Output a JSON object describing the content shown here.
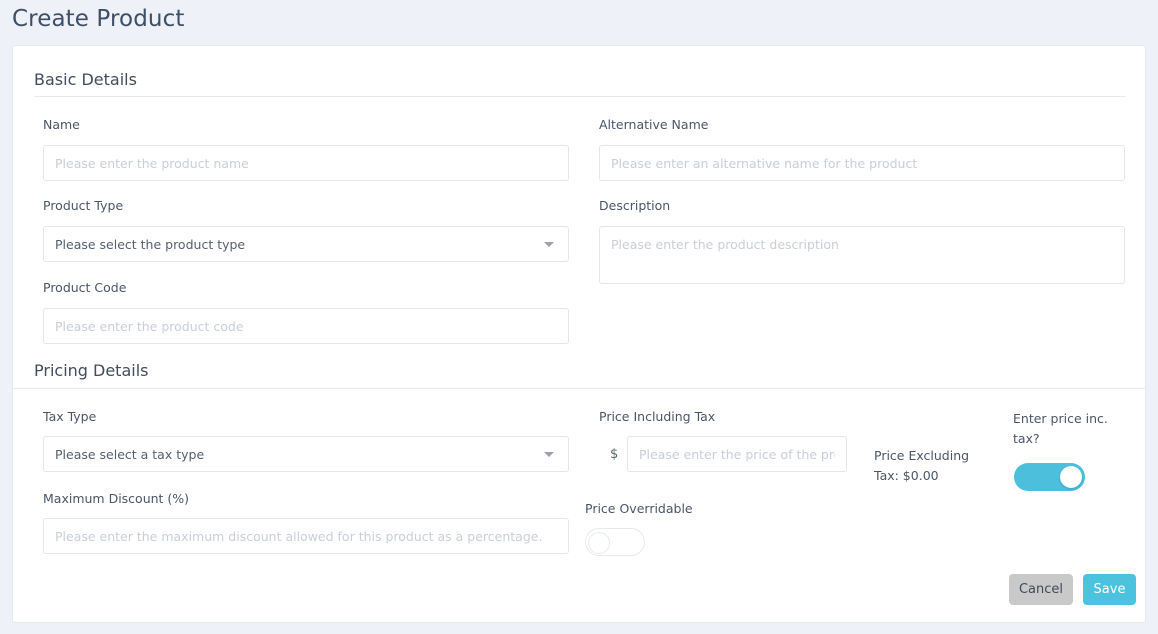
{
  "page": {
    "title": "Create Product"
  },
  "sections": {
    "basic": {
      "title": "Basic Details",
      "fields": {
        "name": {
          "label": "Name",
          "placeholder": "Please enter the product name",
          "value": ""
        },
        "alternative_name": {
          "label": "Alternative Name",
          "placeholder": "Please enter an alternative name for the product",
          "value": ""
        },
        "product_type": {
          "label": "Product Type",
          "selected": "Please select the product type",
          "caret_icon": "chevron-down-icon"
        },
        "description": {
          "label": "Description",
          "placeholder": "Please enter the product description",
          "value": ""
        },
        "product_code": {
          "label": "Product Code",
          "placeholder": "Please enter the product code",
          "value": ""
        }
      }
    },
    "pricing": {
      "title": "Pricing Details",
      "fields": {
        "tax_type": {
          "label": "Tax Type",
          "selected": "Please select a tax type",
          "caret_icon": "chevron-down-icon"
        },
        "maximum_discount": {
          "label": "Maximum Discount (%)",
          "placeholder": "Please enter the maximum discount allowed for this product as a percentage.",
          "value": ""
        },
        "price_including_tax": {
          "label": "Price Including Tax",
          "currency_symbol": "$",
          "placeholder": "Please enter the price of the produc",
          "value": ""
        },
        "price_excluding_tax": {
          "text": "Price Excluding Tax: $0.00"
        },
        "enter_price_inc_tax": {
          "label": "Enter price inc. tax?",
          "state": "on"
        },
        "price_overridable": {
          "label": "Price Overridable",
          "state": "off"
        }
      }
    }
  },
  "actions": {
    "cancel_label": "Cancel",
    "save_label": "Save"
  },
  "colors": {
    "page_background": "#eef1f7",
    "card_background": "#ffffff",
    "title_text": "#3d4f66",
    "accent_toggle_on": "#4cbfdd",
    "save_button": "#4cc3de",
    "cancel_button": "#c9c9c9",
    "field_border": "#e3e6ea",
    "placeholder_text": "#c9cfd7"
  }
}
